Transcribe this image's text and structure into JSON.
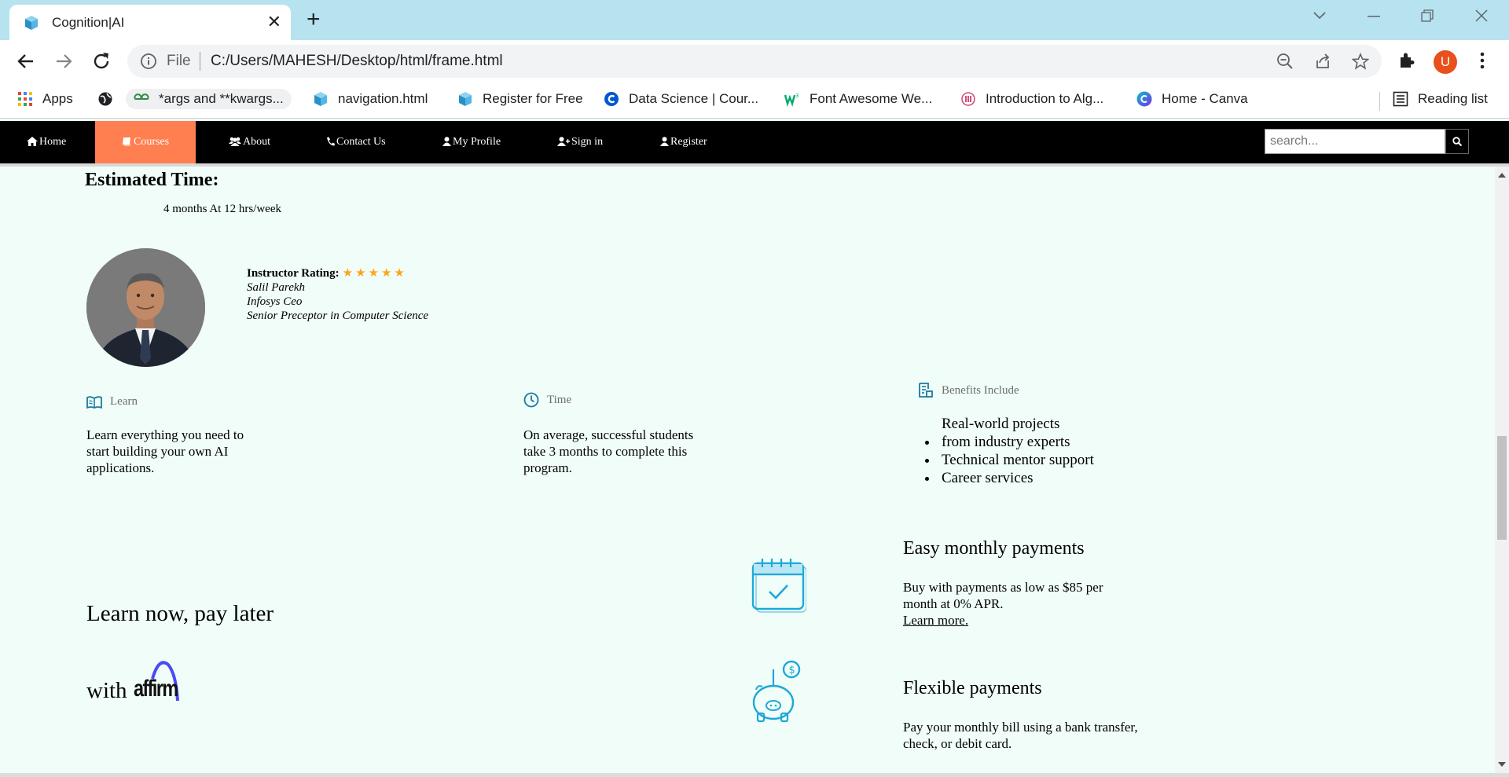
{
  "browser": {
    "tab_title": "Cognition|AI",
    "tab_close": "✕",
    "new_tab": "+",
    "omnibox_scheme": "File",
    "url": "C:/Users/MAHESH/Desktop/html/frame.html",
    "avatar_letter": "U",
    "bookmarks": [
      {
        "label": "Apps",
        "icon": "apps-grid-icon"
      },
      {
        "label": "",
        "icon": "globe-icon"
      },
      {
        "label": "*args and **kwargs...",
        "icon": "geeksforgeeks-icon"
      },
      {
        "label": "navigation.html",
        "icon": "cube-icon"
      },
      {
        "label": "Register for Free",
        "icon": "cube-icon"
      },
      {
        "label": "Data Science | Cour...",
        "icon": "coursera-icon"
      },
      {
        "label": "Font Awesome We...",
        "icon": "w3schools-icon"
      },
      {
        "label": "Introduction to Alg...",
        "icon": "mit-icon"
      },
      {
        "label": "Home - Canva",
        "icon": "canva-icon"
      }
    ],
    "reading_list": "Reading list"
  },
  "nav": {
    "items": [
      {
        "label": "Home",
        "icon": "home-icon"
      },
      {
        "label": "Courses",
        "icon": "book-icon",
        "active": true
      },
      {
        "label": "About",
        "icon": "users-icon"
      },
      {
        "label": "Contact Us",
        "icon": "phone-icon"
      },
      {
        "label": "My Profile",
        "icon": "user-icon"
      },
      {
        "label": "Sign in",
        "icon": "user-plus-icon"
      },
      {
        "label": "Register",
        "icon": "user-icon"
      }
    ],
    "search_placeholder": "search...",
    "active_color": "#ff7f50"
  },
  "estimated": {
    "title": "Estimated Time:",
    "value": "4 months At 12 hrs/week"
  },
  "instructor": {
    "rating_label": "Instructor Rating:",
    "stars": "★★★★★",
    "rating": 5,
    "name": "Salil Parekh",
    "company": "Infosys Ceo",
    "role": "Senior Preceptor in Computer Science"
  },
  "features": {
    "learn": {
      "heading": "Learn",
      "text": "Learn everything you need to start building your own AI applications."
    },
    "time": {
      "heading": "Time",
      "text": "On average, successful students take 3 months to complete this program."
    },
    "benefits": {
      "heading": "Benefits Include",
      "items": [
        "Real-world projects from industry experts",
        "Technical mentor support",
        "Career services"
      ]
    },
    "icon_color": "#1a7aa0"
  },
  "pay_later": {
    "line1": "Learn now, pay later",
    "line2": "with",
    "logo_text": "affirm"
  },
  "payments": {
    "monthly": {
      "title": "Easy monthly payments",
      "text": "Buy with payments as low as $85 per month at 0% APR.",
      "link": "Learn more."
    },
    "flexible": {
      "title": "Flexible payments",
      "text": "Pay your monthly bill using a bank transfer, check, or debit card."
    },
    "icon_color": "#1fa8d8"
  }
}
